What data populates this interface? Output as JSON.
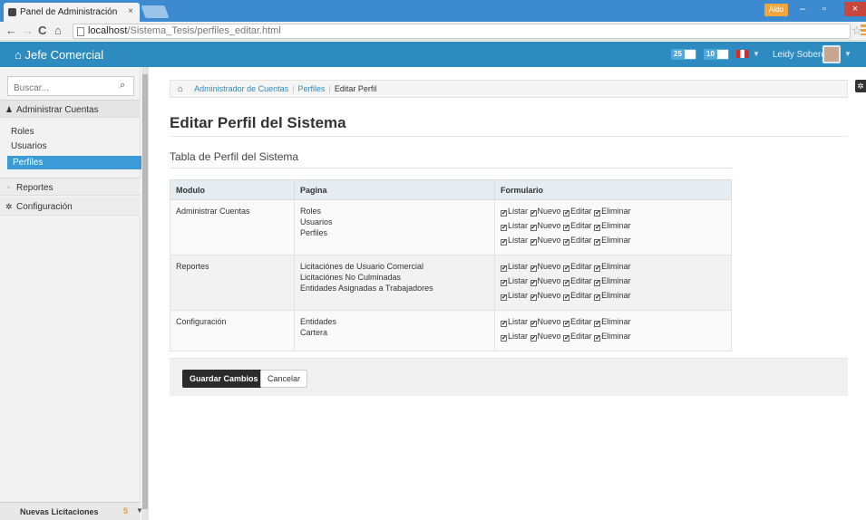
{
  "browser": {
    "tab_title": "Panel de Administración",
    "tab_close": "×",
    "url_host": "localhost",
    "url_path": "/Sistema_Tesis/perfiles_editar.html",
    "window_user": "Aldo"
  },
  "header": {
    "brand": "Jefe Comercial",
    "badge1": "25",
    "badge2": "10",
    "user_name": "Leidy Soberón"
  },
  "sidebar": {
    "search_placeholder": "Buscar...",
    "sections": [
      {
        "label": "Administrar Cuentas",
        "icon": "user-icon"
      },
      {
        "label": "Reportes",
        "icon": "chart-icon"
      },
      {
        "label": "Configuración",
        "icon": "gear-icon"
      }
    ],
    "items": [
      "Roles",
      "Usuarios",
      "Perfiles"
    ],
    "active_item": "Perfiles",
    "footer_label": "Nuevas Licitaciones",
    "footer_count": "5"
  },
  "breadcrumb": {
    "items": [
      "Administrador de Cuentas",
      "Perfiles",
      "Editar Perfil"
    ]
  },
  "page": {
    "title": "Editar Perfil del Sistema",
    "section_title": "Tabla de Perfil del Sistema"
  },
  "table": {
    "headers": [
      "Modulo",
      "Pagina",
      "Formulario"
    ],
    "permissions": [
      "Listar",
      "Nuevo",
      "Editar",
      "Eliminar"
    ],
    "rows": [
      {
        "modulo": "Administrar Cuentas",
        "paginas": [
          "Roles",
          "Usuarios",
          "Perfiles"
        ]
      },
      {
        "modulo": "Reportes",
        "paginas": [
          "Licitaciónes de Usuario Comercial",
          "Licitaciónes No Culminadas",
          "Entidades Asignadas a Trabajadores"
        ]
      },
      {
        "modulo": "Configuración",
        "paginas": [
          "Entidades",
          "Cartera"
        ]
      }
    ]
  },
  "actions": {
    "save_label": "Guardar Cambios",
    "cancel_label": "Cancelar"
  },
  "colors": {
    "primary": "#2e8bc0",
    "active_item": "#3c9ad6",
    "save_button": "#2b2b2b"
  }
}
